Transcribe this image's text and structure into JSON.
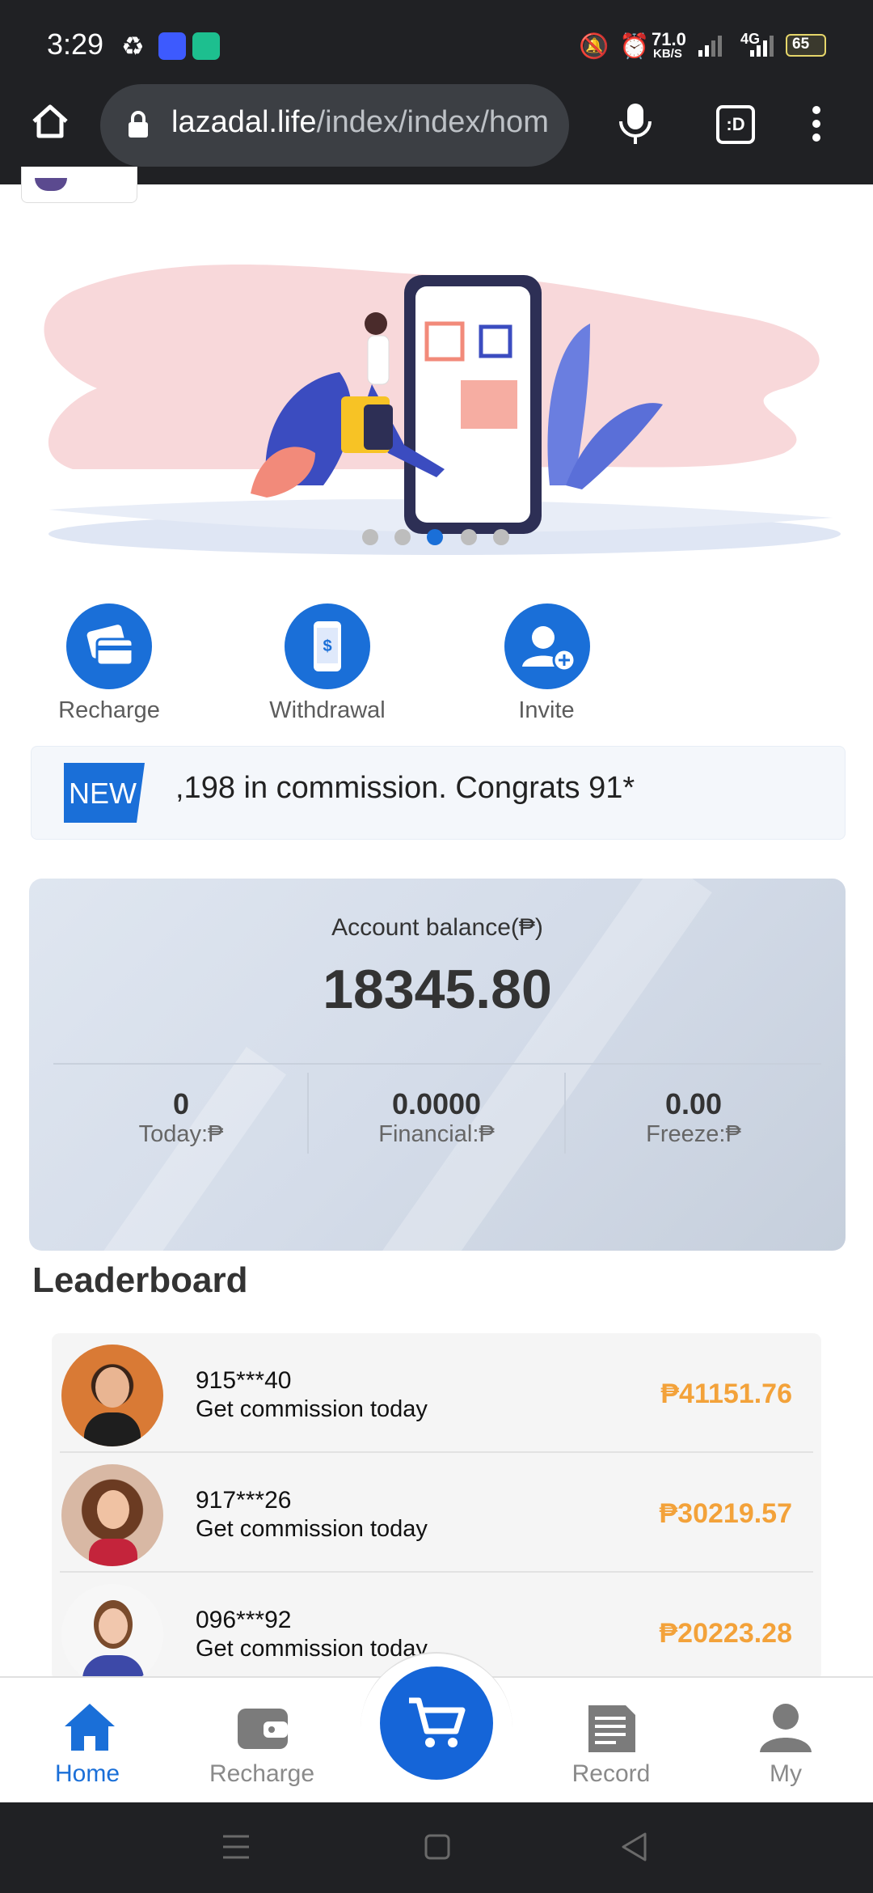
{
  "status_bar": {
    "time": "3:29",
    "net_speed": "71.0",
    "net_unit": "KB/S",
    "network": "4G",
    "battery": "65"
  },
  "browser": {
    "url_host": "lazadal.life",
    "url_path": "/index/index/hom",
    "icons": [
      "home-icon",
      "lock-icon",
      "mic-icon",
      "tab-switcher-icon",
      "overflow-menu-icon"
    ]
  },
  "banner": {
    "dots": 5,
    "active_dot": 2
  },
  "quick_actions": [
    {
      "label": "Recharge",
      "icon": "card-icon"
    },
    {
      "label": "Withdrawal",
      "icon": "phone-dollar-icon"
    },
    {
      "label": "Invite",
      "icon": "add-user-icon"
    }
  ],
  "marquee": {
    "badge": "NEW",
    "text": ",198 in commission. Congrats 91*"
  },
  "balance": {
    "label": "Account balance(₱)",
    "value": "18345.80",
    "stats": [
      {
        "value": "0",
        "label": "Today:₱"
      },
      {
        "value": "0.0000",
        "label": "Financial:₱"
      },
      {
        "value": "0.00",
        "label": "Freeze:₱"
      }
    ]
  },
  "leaderboard": {
    "title": "Leaderboard",
    "rows": [
      {
        "id": "915***40",
        "subtitle": "Get commission today",
        "amount": "₱41151.76"
      },
      {
        "id": "917***26",
        "subtitle": "Get commission today",
        "amount": "₱30219.57"
      },
      {
        "id": "096***92",
        "subtitle": "Get commission today",
        "amount": "₱20223.28"
      }
    ]
  },
  "tabbar": {
    "home": "Home",
    "recharge": "Recharge",
    "record": "Record",
    "my": "My"
  },
  "colors": {
    "accent": "#1a6fd8",
    "amount": "#f3a23a",
    "dark_bar": "#202124"
  }
}
